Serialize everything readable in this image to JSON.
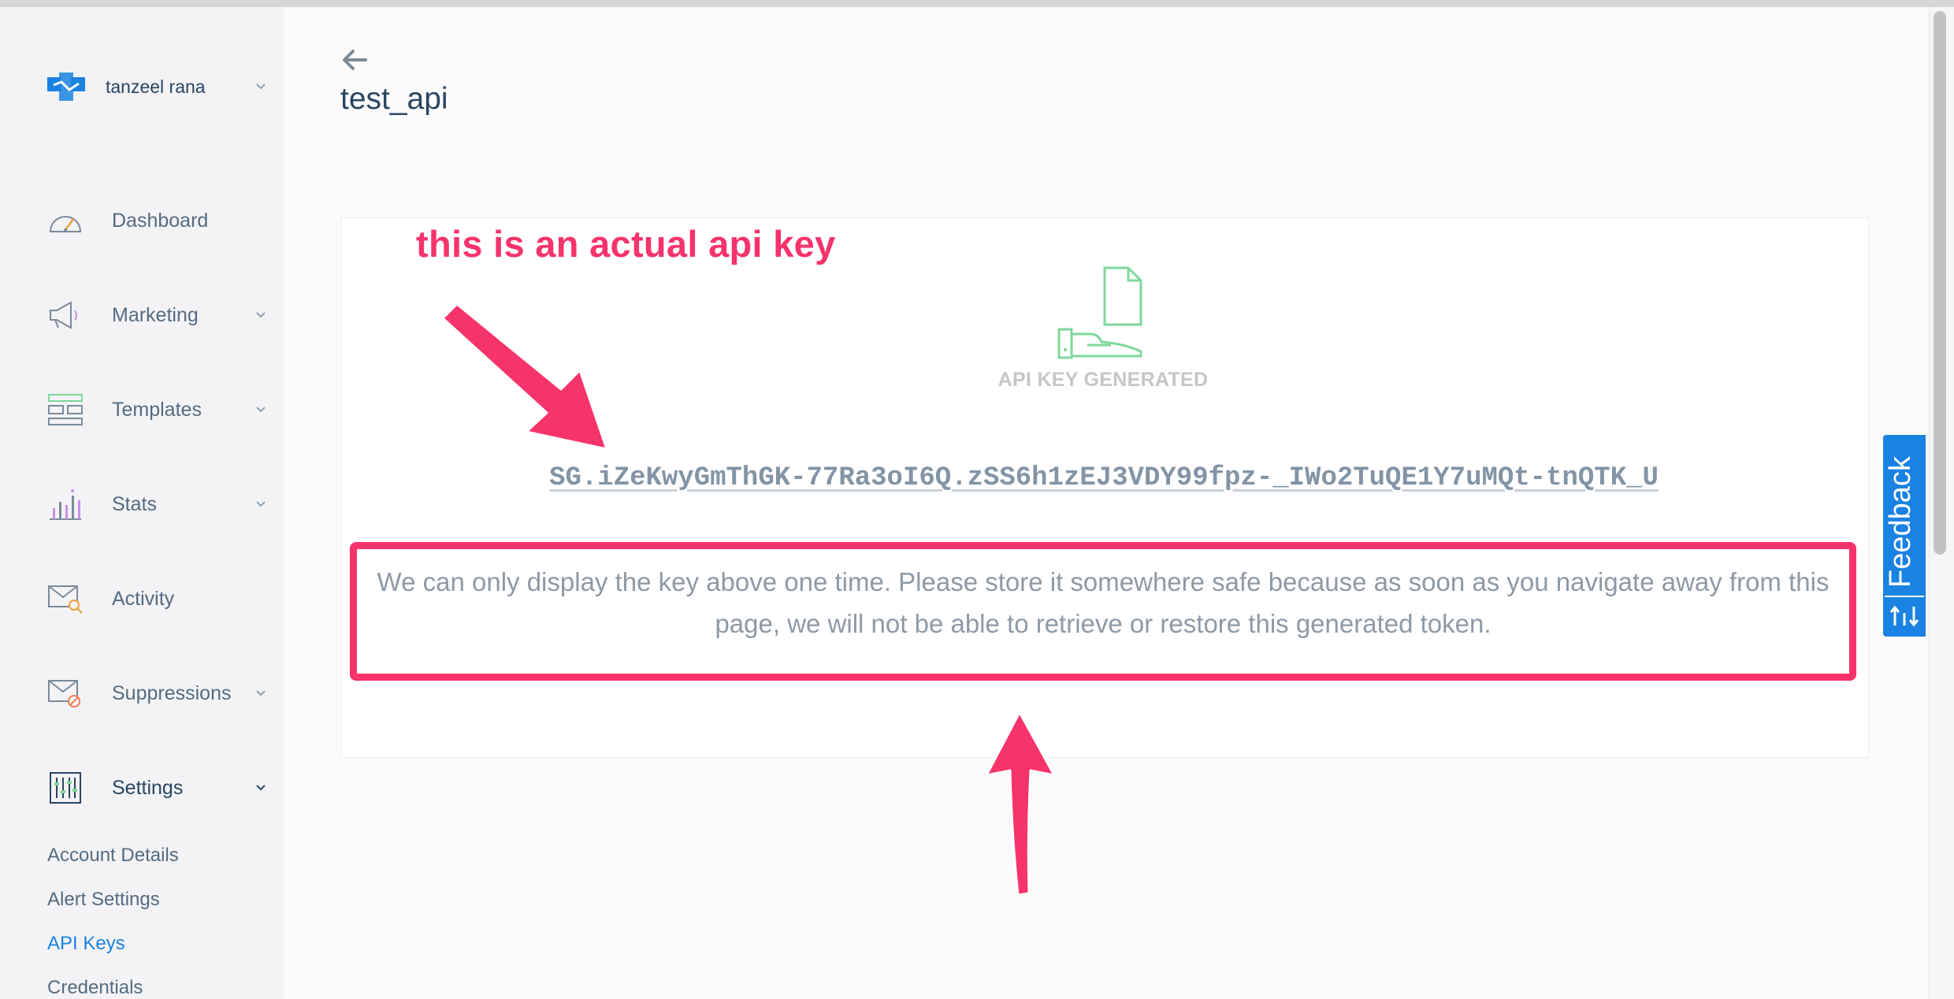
{
  "account": {
    "name": "tanzeel rana"
  },
  "nav": {
    "dashboard": "Dashboard",
    "marketing": "Marketing",
    "templates": "Templates",
    "stats": "Stats",
    "activity": "Activity",
    "suppressions": "Suppressions",
    "settings": "Settings"
  },
  "settings_sub": {
    "account_details": "Account Details",
    "alert_settings": "Alert Settings",
    "api_keys": "API Keys",
    "credentials": "Credentials"
  },
  "page": {
    "title": "test_api"
  },
  "card": {
    "generated_label": "API KEY GENERATED",
    "api_key": "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",
    "notice": "We can only display the key above one time. Please store it somewhere safe because as soon as you navigate away from this page, we will not be able to retrieve or restore this generated token."
  },
  "annotation": {
    "text": "this is an actual api key"
  },
  "feedback": {
    "label": "Feedback"
  },
  "icons": {
    "logo": "sendgrid-logo-icon",
    "dashboard": "speedometer-icon",
    "marketing": "megaphone-icon",
    "templates": "templates-icon",
    "stats": "bar-chart-icon",
    "activity": "envelope-search-icon",
    "suppressions": "envelope-blocked-icon",
    "settings": "sliders-icon",
    "generated": "hand-document-icon"
  },
  "colors": {
    "accent": "#1a82e2",
    "annotation": "#f7336b",
    "generated_icon": "#7fd79b"
  }
}
